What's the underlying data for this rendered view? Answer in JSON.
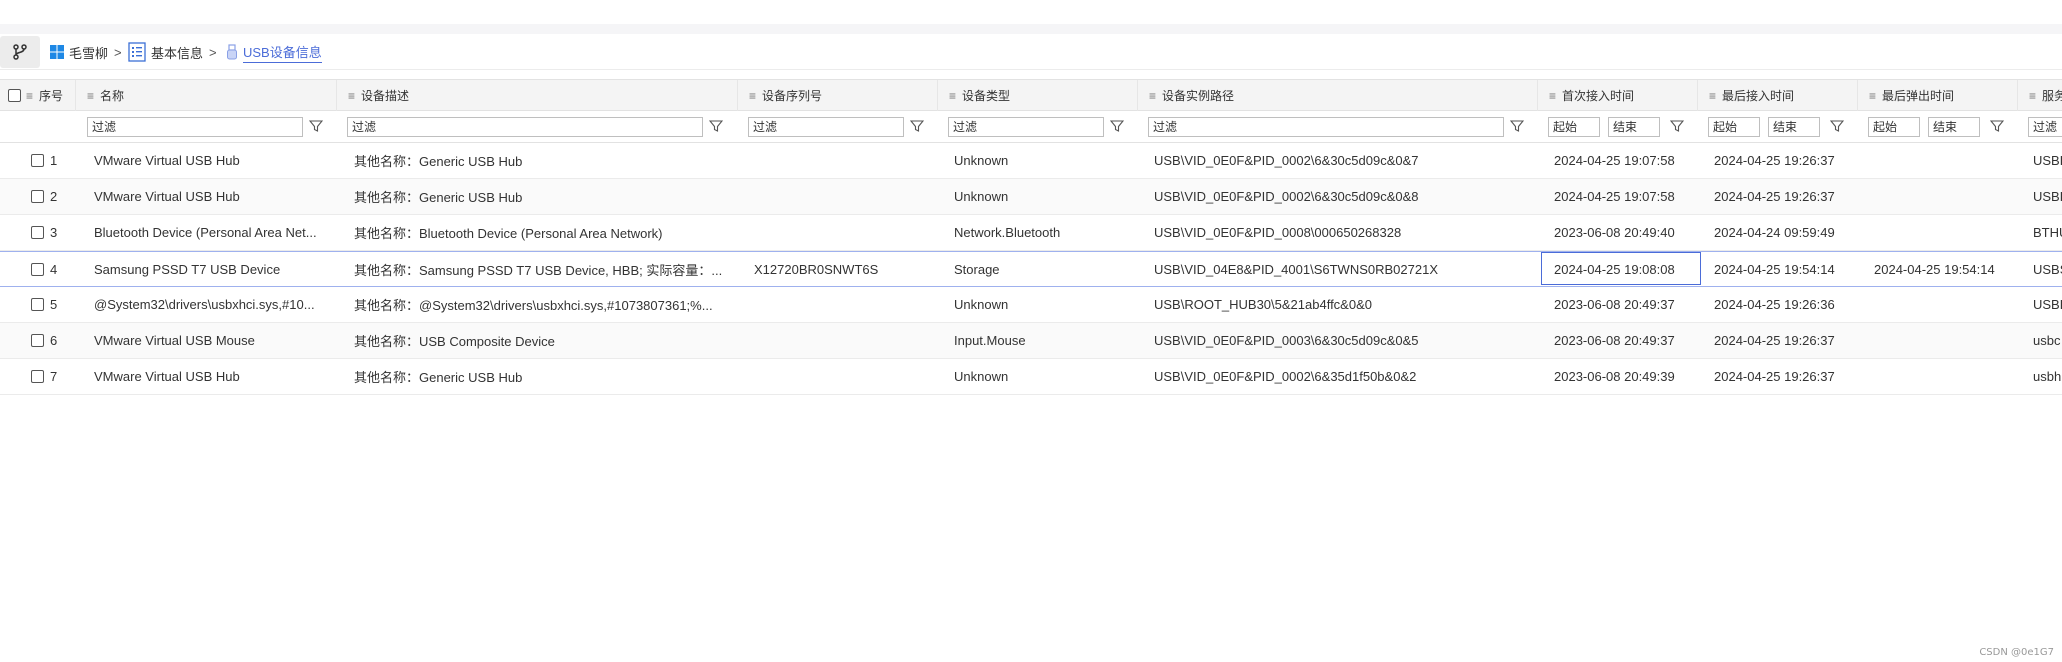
{
  "breadcrumb": {
    "items": [
      {
        "label": "毛雪柳",
        "icon": "windows-logo-icon"
      },
      {
        "label": "基本信息",
        "icon": "document-list-icon"
      },
      {
        "label": "USB设备信息",
        "icon": "usb-icon"
      }
    ],
    "separator": ">"
  },
  "columns": [
    {
      "key": "seq",
      "label": "序号"
    },
    {
      "key": "name",
      "label": "名称"
    },
    {
      "key": "desc",
      "label": "设备描述"
    },
    {
      "key": "serial",
      "label": "设备序列号"
    },
    {
      "key": "type",
      "label": "设备类型"
    },
    {
      "key": "path",
      "label": "设备实例路径"
    },
    {
      "key": "first",
      "label": "首次接入时间"
    },
    {
      "key": "last",
      "label": "最后接入时间"
    },
    {
      "key": "eject",
      "label": "最后弹出时间"
    },
    {
      "key": "svc",
      "label": "服务"
    }
  ],
  "filters": {
    "placeholder": "过滤",
    "start": "起始",
    "end": "结束"
  },
  "rows": [
    {
      "seq": "1",
      "name": "VMware Virtual USB Hub",
      "desc": "其他名称：Generic USB Hub",
      "serial": "",
      "type": "Unknown",
      "path": "USB\\VID_0E0F&PID_0002\\6&30c5d09c&0&7",
      "first": "2024-04-25 19:07:58",
      "last": "2024-04-25 19:26:37",
      "eject": "",
      "svc": "USBH"
    },
    {
      "seq": "2",
      "name": "VMware Virtual USB Hub",
      "desc": "其他名称：Generic USB Hub",
      "serial": "",
      "type": "Unknown",
      "path": "USB\\VID_0E0F&PID_0002\\6&30c5d09c&0&8",
      "first": "2024-04-25 19:07:58",
      "last": "2024-04-25 19:26:37",
      "eject": "",
      "svc": "USBH"
    },
    {
      "seq": "3",
      "name": "Bluetooth Device (Personal Area Net...",
      "desc": "其他名称：Bluetooth Device (Personal Area Network)",
      "serial": "",
      "type": "Network.Bluetooth",
      "path": "USB\\VID_0E0F&PID_0008\\000650268328",
      "first": "2023-06-08 20:49:40",
      "last": "2024-04-24 09:59:49",
      "eject": "",
      "svc": "BTHU"
    },
    {
      "seq": "4",
      "name": "Samsung PSSD T7 USB Device",
      "desc": "其他名称：Samsung PSSD T7 USB Device, HBB; 实际容量：...",
      "serial": "X12720BR0SNWT6S",
      "type": "Storage",
      "path": "USB\\VID_04E8&PID_4001\\S6TWNS0RB02721X",
      "first": "2024-04-25 19:08:08",
      "last": "2024-04-25 19:54:14",
      "eject": "2024-04-25 19:54:14",
      "svc": "USBS"
    },
    {
      "seq": "5",
      "name": "@System32\\drivers\\usbxhci.sys,#10...",
      "desc": "其他名称：@System32\\drivers\\usbxhci.sys,#1073807361;%...",
      "serial": "",
      "type": "Unknown",
      "path": "USB\\ROOT_HUB30\\5&21ab4ffc&0&0",
      "first": "2023-06-08 20:49:37",
      "last": "2024-04-25 19:26:36",
      "eject": "",
      "svc": "USBH"
    },
    {
      "seq": "6",
      "name": "VMware Virtual USB Mouse",
      "desc": "其他名称：USB Composite Device",
      "serial": "",
      "type": "Input.Mouse",
      "path": "USB\\VID_0E0F&PID_0003\\6&30c5d09c&0&5",
      "first": "2023-06-08 20:49:37",
      "last": "2024-04-25 19:26:37",
      "eject": "",
      "svc": "usbc"
    },
    {
      "seq": "7",
      "name": "VMware Virtual USB Hub",
      "desc": "其他名称：Generic USB Hub",
      "serial": "",
      "type": "Unknown",
      "path": "USB\\VID_0E0F&PID_0002\\6&35d1f50b&0&2",
      "first": "2023-06-08 20:49:39",
      "last": "2024-04-25 19:26:37",
      "eject": "",
      "svc": "usbh"
    }
  ],
  "selected_row": 3,
  "watermark": "CSDN @0e1G7"
}
